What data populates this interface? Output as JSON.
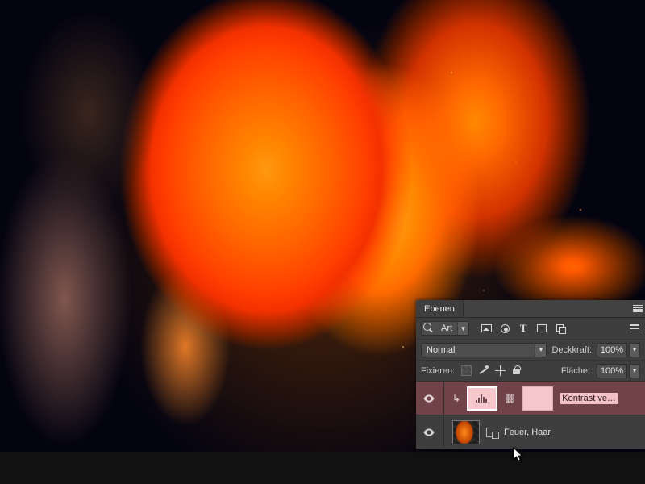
{
  "panel": {
    "tab": "Ebenen",
    "search_label": "Art",
    "blend_mode": "Normal",
    "opacity_label": "Deckkraft:",
    "opacity_value": "100%",
    "lock_label": "Fixieren:",
    "fill_label": "Fläche:",
    "fill_value": "100%"
  },
  "layers": [
    {
      "name": "Kontrast ve…",
      "type": "adjustment",
      "visible": true,
      "active": true
    },
    {
      "name": "Feuer, Haar",
      "type": "smart-object",
      "visible": true,
      "active": false
    }
  ]
}
